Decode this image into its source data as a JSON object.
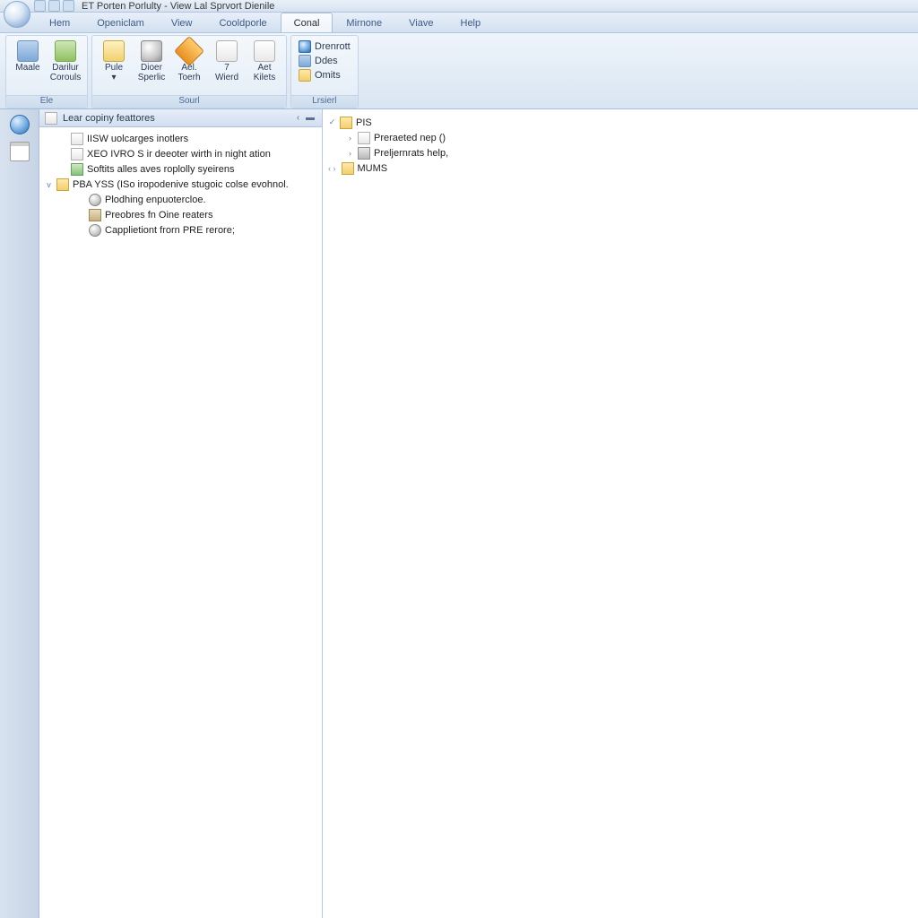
{
  "titlebar": {
    "title": "ET Porten Porlulty - View Lal Sprvort Dienile"
  },
  "menu": {
    "tabs": [
      {
        "label": "Hem"
      },
      {
        "label": "Openiclam"
      },
      {
        "label": "View"
      },
      {
        "label": "Cooldporle"
      },
      {
        "label": "Conal",
        "active": true
      },
      {
        "label": "Mirnone"
      },
      {
        "label": "Viave"
      },
      {
        "label": "Help"
      }
    ]
  },
  "ribbon": {
    "groups": [
      {
        "label": "Ele",
        "buttons": [
          {
            "l1": "Maale",
            "l2": "",
            "icon": "ic-blue"
          },
          {
            "l1": "Darilur",
            "l2": "Corouls",
            "icon": "ic-green"
          }
        ],
        "quick": "▾"
      },
      {
        "label": "Sourl",
        "buttons": [
          {
            "l1": "Pule",
            "l2": "▾",
            "icon": "ic-yellow"
          },
          {
            "l1": "Dioer",
            "l2": "Sperlic",
            "icon": "ic-grey"
          },
          {
            "l1": "Ael.",
            "l2": "Toerh",
            "icon": "ic-diamond"
          },
          {
            "l1": "7",
            "l2": "Wierd",
            "icon": "ic-page"
          },
          {
            "l1": "Aet",
            "l2": "Kilets",
            "icon": "ic-page"
          }
        ]
      },
      {
        "label": "Lrsierl",
        "small": [
          {
            "label": "Drenrott",
            "icon": "ic-globe"
          },
          {
            "label": "Ddes",
            "icon": "ic-blue"
          },
          {
            "label": "Omits",
            "icon": "ic-folder"
          }
        ]
      }
    ]
  },
  "leftpane": {
    "header": "Lear copiny feattores",
    "header_ctrls": "‹ ▬ ",
    "tree": [
      {
        "level": 1,
        "twist": "",
        "icon": "ic-page",
        "label": "IISW uolcarges inotlers"
      },
      {
        "level": 1,
        "twist": "",
        "icon": "ic-page",
        "label": "XEO IVRO S ir deeoter wirth in night ation"
      },
      {
        "level": 1,
        "twist": "",
        "icon": "ic-pic",
        "label": "Softits alles aves roplolly syeirens"
      },
      {
        "level": 0,
        "twist": "v",
        "icon": "ic-folder",
        "label": "PBA YSS (ISo iropodenive stugoic colse evohnol."
      },
      {
        "level": 2,
        "twist": "",
        "icon": "ic-grey",
        "label": "Plodhing enpuotercloe."
      },
      {
        "level": 2,
        "twist": "",
        "icon": "ic-box",
        "label": "Preobres fn Oine reaters"
      },
      {
        "level": 2,
        "twist": "",
        "icon": "ic-grey",
        "label": "Capplietiont frorn PRE rerore;"
      }
    ]
  },
  "rightpane": {
    "tree": [
      {
        "level": 0,
        "twist": "✓",
        "icon": "ic-folder",
        "label": "PIS"
      },
      {
        "level": 1,
        "twist": "›",
        "icon": "ic-page",
        "label": "Preraeted nep ()"
      },
      {
        "level": 1,
        "twist": "›",
        "icon": "ic-wrench",
        "label": "Preljernrats help,"
      },
      {
        "level": 0,
        "nav": true,
        "icon": "ic-folder",
        "label": "MUMS"
      }
    ]
  }
}
